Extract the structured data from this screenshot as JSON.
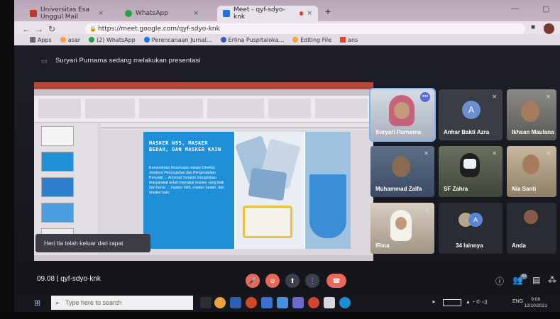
{
  "browser": {
    "tabs": [
      {
        "label": "Universitas Esa Unggul Mail",
        "color": "#c0392b"
      },
      {
        "label": "WhatsApp",
        "color": "#25a244"
      },
      {
        "label": "Meet - qyf-sdyo-knk",
        "color": "#1a73e8",
        "active": true
      }
    ],
    "new_tab": "+",
    "url": "https://meet.google.com/qyf-sdyo-knk",
    "bookmarks": [
      {
        "label": "Apps",
        "color": "#6b6b6b"
      },
      {
        "label": "asar",
        "color": "#f2a33a"
      },
      {
        "label": "(2) WhatsApp",
        "color": "#25a244"
      },
      {
        "label": "Perencanaan Jurnal...",
        "color": "#1a73e8"
      },
      {
        "label": "Erlina Puspitaloka...",
        "color": "#3b5bb8"
      },
      {
        "label": "Editing File",
        "color": "#f2a33a"
      },
      {
        "label": "ans",
        "color": "#e0452f"
      }
    ]
  },
  "meet": {
    "presenting_text": "Suryari Purnama sedang melakukan presentasi",
    "slide": {
      "title": "MASKER N95, MASKER BEDAH, DAN MASKER KAIN",
      "body": "Kementerian Kesehatan melalui Direktur Jenderal Pencegahan dan Pengendalian Penyakit ... Achmad Yurianto mengimbau masyarakat untuk memakai masker yang baik dan benar ... masker N95, masker bedah, dan masker kain."
    },
    "toast": "Heri Ila telah keluar dari rapat",
    "participants": [
      {
        "name": "Suryari Purnama",
        "speaking": true
      },
      {
        "name": "Anhar Bakti Azra",
        "avatar_letter": "A",
        "avatar_color": "#6b8fd1"
      },
      {
        "name": "Ikhsan Maulana"
      },
      {
        "name": "Muhammad Zalfa"
      },
      {
        "name": "SF Zahra"
      },
      {
        "name": "Nia Santi"
      },
      {
        "name": "IRma"
      },
      {
        "name": "34 lainnya",
        "avatar_letter": "A"
      },
      {
        "name": "Anda"
      }
    ],
    "bar": {
      "time": "09.08",
      "separator": "|",
      "meeting_code": "qyf-sdyo-knk",
      "people_count": "43"
    }
  },
  "taskbar": {
    "search_placeholder": "Type here to search",
    "lang": "ENG",
    "time": "9:08",
    "date": "12/10/2021"
  }
}
